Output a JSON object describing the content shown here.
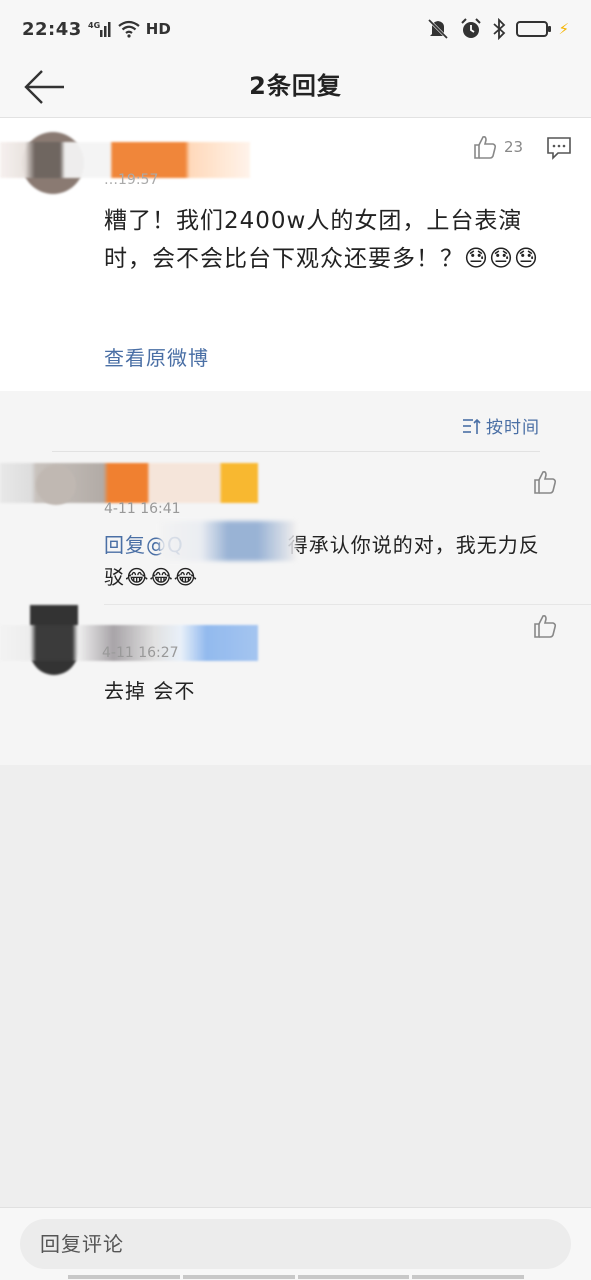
{
  "status_bar": {
    "time": "22:43",
    "network": "4G",
    "hd": "HD",
    "battery_level": 0.8,
    "icons": [
      "signal-icon",
      "wifi-icon",
      "mute-icon",
      "alarm-icon",
      "bluetooth-icon",
      "battery-icon",
      "charging-icon"
    ]
  },
  "nav": {
    "title": "2条回复",
    "back_icon": "arrow-left-icon"
  },
  "main_comment": {
    "time": "…19:57",
    "likes": "23",
    "text": "糟了！我们2400w人的女团，上台表演时，会不会比台下观众还要多！？😓😓😓",
    "view_original": "查看原微博"
  },
  "sort": {
    "label": "按时间"
  },
  "replies": [
    {
      "time": "4-11 16:41",
      "text_prefix": "回复@Q",
      "text_suffix": "得承认你说的对，我无力反驳😂😂😂"
    },
    {
      "time": "4-11 16:27",
      "text": "去掉 会不"
    }
  ],
  "input": {
    "placeholder": "回复评论"
  },
  "colors": {
    "link": "#4a6fa5",
    "battery": "#f5c518"
  }
}
